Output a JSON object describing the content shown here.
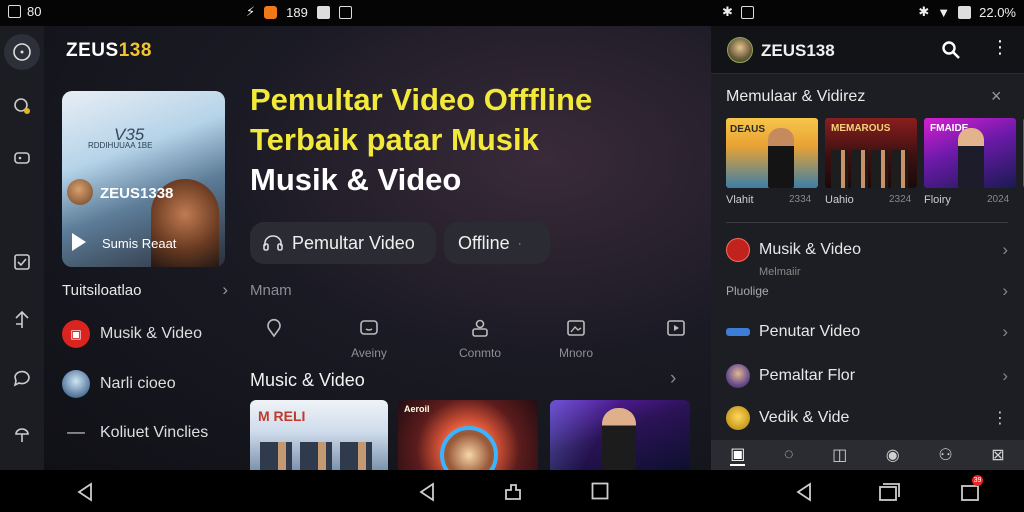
{
  "status_bar": {
    "left_time": "80",
    "mid_text": "189",
    "right_battery": "22.0%",
    "icons": [
      "screenshot-icon",
      "app-icon",
      "bolt-icon",
      "notification-icon",
      "image-icon",
      "bluetooth-icon",
      "wifi-icon",
      "battery-icon"
    ]
  },
  "rail": {
    "items": [
      "home-icon",
      "search-icon",
      "gamepad-icon",
      "check-icon",
      "share-icon",
      "chat-icon",
      "cloud-icon"
    ]
  },
  "main": {
    "logo_part_a": "ZEUS",
    "logo_part_b": "138",
    "featured": {
      "scribble": "V35",
      "small_text": "RDDIHUUAA 1BE",
      "name": "ZEUS1338",
      "caption": "Sumis Reaat"
    },
    "headline": {
      "line1": "Pemultar Video Offfline",
      "line2": "Terbaik patar Musik",
      "line3": "Musik & Video"
    },
    "pills": [
      {
        "label": "Pemultar Video",
        "icon": "headset-icon"
      },
      {
        "label": "Offline",
        "suffix": "·"
      }
    ],
    "section_label": "Tuitsiloatlao",
    "list": [
      {
        "label": "Musik & Video",
        "icon": "music-red-icon"
      },
      {
        "label": "Narli cioeo",
        "icon": "photo-avatar"
      },
      {
        "label": "Koliuet Vinclies",
        "icon": "dash-icon"
      }
    ],
    "mix_label": "Mnam",
    "categories": [
      {
        "label": "",
        "icon": "pin-icon"
      },
      {
        "label": "Aveiny",
        "icon": "tv-icon"
      },
      {
        "label": "Conmto",
        "icon": "user-box-icon"
      },
      {
        "label": "Mnoro",
        "icon": "image-box-icon"
      },
      {
        "label": "",
        "icon": "play-box-icon"
      }
    ],
    "music_video_title": "Music & Video",
    "thumbs": [
      {
        "text": "M RELI"
      },
      {
        "text": "Aeroil"
      },
      {
        "text": ""
      }
    ]
  },
  "right_panel": {
    "title": "ZEUS138",
    "section_title": "Memulaar & Vidirez",
    "thumbs": [
      {
        "text": "DEAUS",
        "caption": "Vlahit",
        "year": "2334"
      },
      {
        "text": "MEMAROUS",
        "caption": "Uahio",
        "year": "2324"
      },
      {
        "text": "FMAIDE",
        "caption": "Floiry",
        "year": "2024"
      }
    ],
    "rows": [
      {
        "label": "Musik & Video",
        "sub": "Melmaiir"
      },
      {
        "label": "Pluolige"
      },
      {
        "label": "Penutar Video"
      },
      {
        "label": "Pemaltar Flor"
      },
      {
        "label": "Vedik & Vide"
      }
    ],
    "bottom_nav": [
      "home-icon",
      "chat-icon",
      "box-icon",
      "group-icon",
      "people-icon",
      "store-icon"
    ]
  },
  "nav_bar": {
    "badge": "39"
  }
}
